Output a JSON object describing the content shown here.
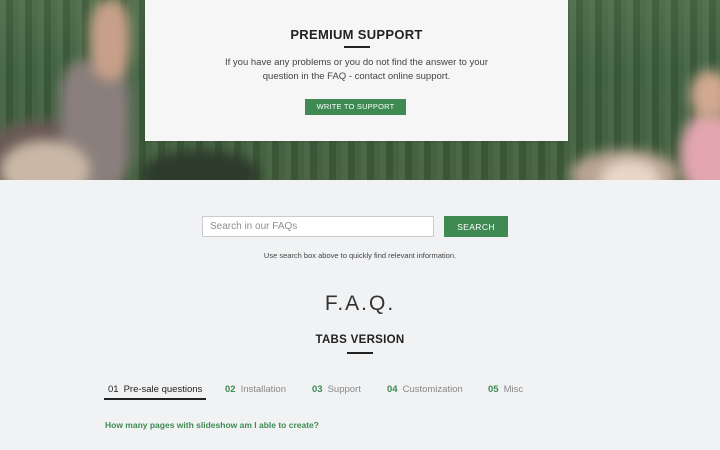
{
  "support": {
    "title": "PREMIUM SUPPORT",
    "text": "If you have any problems or you do not find the answer to your question in the FAQ - contact online support.",
    "button_label": "WRITE TO SUPPORT"
  },
  "search": {
    "placeholder": "Search in our FAQs",
    "button_label": "SEARCH",
    "hint": "Use search box above to quickly find relevant information."
  },
  "faq": {
    "title": "F.A.Q.",
    "tabs_title": "TABS VERSION",
    "tabs": [
      {
        "num": "01",
        "label": "Pre-sale questions",
        "active": true
      },
      {
        "num": "02",
        "label": "Installation",
        "active": false
      },
      {
        "num": "03",
        "label": "Support",
        "active": false
      },
      {
        "num": "04",
        "label": "Customization",
        "active": false
      },
      {
        "num": "05",
        "label": "Misc",
        "active": false
      }
    ],
    "first_question": "How many pages with slideshow am I able to create?"
  },
  "colors": {
    "accent": "#3e8a52",
    "background": "#f1f2f4",
    "card": "#f6f6f6",
    "text": "#333333"
  }
}
